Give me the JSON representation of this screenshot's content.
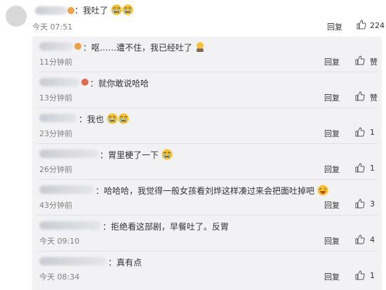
{
  "main_comment": {
    "text": "：我吐了",
    "time": "今天 07:51",
    "reply_label": "回复",
    "like_count": "224"
  },
  "replies": [
    {
      "text": "：呕……遭不住，我已经吐了",
      "time": "11分钟前",
      "reply_label": "回复",
      "like_count": "赞",
      "emoji": [
        "sick-emoji"
      ]
    },
    {
      "text": "：就你敢说哈哈",
      "time": "13分钟前",
      "reply_label": "回复",
      "like_count": "赞",
      "emoji": []
    },
    {
      "text": "：我也",
      "time": "23分钟前",
      "reply_label": "回复",
      "like_count": "1",
      "emoji": [
        "crying-emoji",
        "crying-emoji"
      ]
    },
    {
      "text": "：胃里梗了一下",
      "time": "26分钟前",
      "reply_label": "回复",
      "like_count": "1",
      "emoji": [
        "crying-emoji"
      ]
    },
    {
      "text": "：哈哈哈，我觉得一般女孩看刘烨这样凑过来会把面吐掉吧",
      "time": "43分钟前",
      "reply_label": "回复",
      "like_count": "3",
      "emoji": [
        "laughing-emoji"
      ]
    },
    {
      "text": "：拒绝看这部剧，早餐吐了。反胃",
      "time": "今天 09:10",
      "reply_label": "回复",
      "like_count": "4",
      "emoji": []
    },
    {
      "text": "：真有点",
      "time": "今天 08:34",
      "reply_label": "回复",
      "like_count": "1",
      "emoji": []
    }
  ],
  "colors": {
    "reply_background": "#f2f2f5",
    "meta_text": "#808080",
    "emoji_face": "#f6c231"
  }
}
